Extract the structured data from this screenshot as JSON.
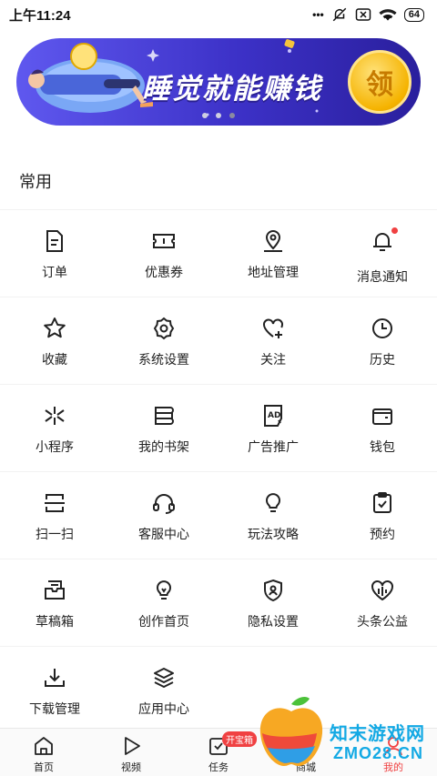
{
  "status_bar": {
    "time": "上午11:24",
    "dots": "•••",
    "battery": "64"
  },
  "banner": {
    "title": "睡觉就能赚钱",
    "coin_label": "领",
    "page_count": 3,
    "active_page": 3
  },
  "section": {
    "title": "常用"
  },
  "grid": [
    [
      {
        "label": "订单",
        "icon": "document-icon"
      },
      {
        "label": "优惠券",
        "icon": "ticket-icon"
      },
      {
        "label": "地址管理",
        "icon": "location-pin-icon"
      },
      {
        "label": "消息通知",
        "icon": "bell-icon",
        "dot": true
      }
    ],
    [
      {
        "label": "收藏",
        "icon": "star-icon"
      },
      {
        "label": "系统设置",
        "icon": "gear-icon"
      },
      {
        "label": "关注",
        "icon": "heart-plus-icon"
      },
      {
        "label": "历史",
        "icon": "clock-icon"
      }
    ],
    [
      {
        "label": "小程序",
        "icon": "mini-program-icon"
      },
      {
        "label": "我的书架",
        "icon": "bookshelf-icon"
      },
      {
        "label": "广告推广",
        "icon": "ad-icon"
      },
      {
        "label": "钱包",
        "icon": "wallet-icon"
      }
    ],
    [
      {
        "label": "扫一扫",
        "icon": "scan-icon"
      },
      {
        "label": "客服中心",
        "icon": "headset-icon"
      },
      {
        "label": "玩法攻略",
        "icon": "lightbulb-icon"
      },
      {
        "label": "预约",
        "icon": "clipboard-check-icon"
      }
    ],
    [
      {
        "label": "草稿箱",
        "icon": "inbox-icon"
      },
      {
        "label": "创作首页",
        "icon": "bulb-pen-icon"
      },
      {
        "label": "隐私设置",
        "icon": "shield-user-icon"
      },
      {
        "label": "头条公益",
        "icon": "heart-chart-icon"
      }
    ],
    [
      {
        "label": "下载管理",
        "icon": "download-icon"
      },
      {
        "label": "应用中心",
        "icon": "layers-icon"
      }
    ]
  ],
  "tab_bar": {
    "tabs": [
      {
        "label": "首页",
        "icon": "home-icon"
      },
      {
        "label": "视频",
        "icon": "play-icon"
      },
      {
        "label": "任务",
        "icon": "task-icon"
      },
      {
        "label": "商城",
        "icon": "shop-icon"
      },
      {
        "label": "我的",
        "icon": "person-icon"
      }
    ],
    "task_badge": "开宝箱",
    "active_index": 4
  },
  "watermark": {
    "line1": "知末游戏网",
    "line2": "ZMO28.CN"
  },
  "colors": {
    "banner_start": "#5f58ef",
    "banner_end": "#2a1f9d",
    "accent_red": "#f04142",
    "coin_gold": "#f5b300"
  }
}
